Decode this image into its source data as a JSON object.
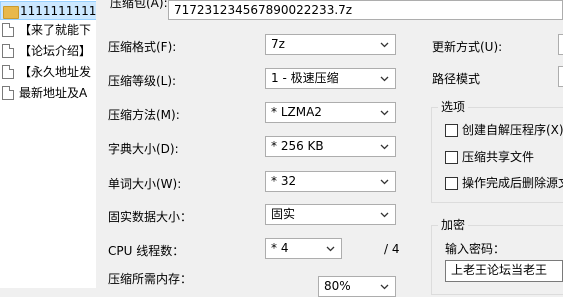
{
  "explorer": {
    "items": [
      {
        "name": "1111111111",
        "icon": "folder-icon"
      },
      {
        "name": "【来了就能下",
        "icon": "document-icon"
      },
      {
        "name": "【论坛介绍】",
        "icon": "document-icon"
      },
      {
        "name": "【永久地址发",
        "icon": "document-icon"
      },
      {
        "name": "最新地址及A",
        "icon": "document-icon"
      }
    ]
  },
  "dialog": {
    "archive_label": "压缩包(A):",
    "archive_name": "717231234567890022233.7z",
    "format": {
      "label": "压缩格式(F):",
      "value": "7z"
    },
    "level": {
      "label": "压缩等级(L):",
      "value": "1 - 极速压缩"
    },
    "method": {
      "label": "压缩方法(M):",
      "value": "* LZMA2"
    },
    "dictionary": {
      "label": "字典大小(D):",
      "value": "* 256 KB"
    },
    "word_size": {
      "label": "单词大小(W):",
      "value": "* 32"
    },
    "solid": {
      "label": "固实数据大小：",
      "value": "固实"
    },
    "cpu_threads": {
      "label": "CPU 线程数：",
      "value": "* 4",
      "total": "/ 4"
    },
    "memory": {
      "label": "压缩所需内存：",
      "value": "80%"
    },
    "update_mode": {
      "label": "更新方式(U):"
    },
    "path_mode": {
      "label": "路径模式"
    },
    "options": {
      "title": "选项",
      "create_sfx": "创建自解压程序(X)",
      "compress_shared": "压缩共享文件",
      "delete_after": "操作完成后删除源文"
    },
    "encryption": {
      "title": "加密",
      "password_label": "输入密码：",
      "password_value": "上老王论坛当老王"
    }
  }
}
